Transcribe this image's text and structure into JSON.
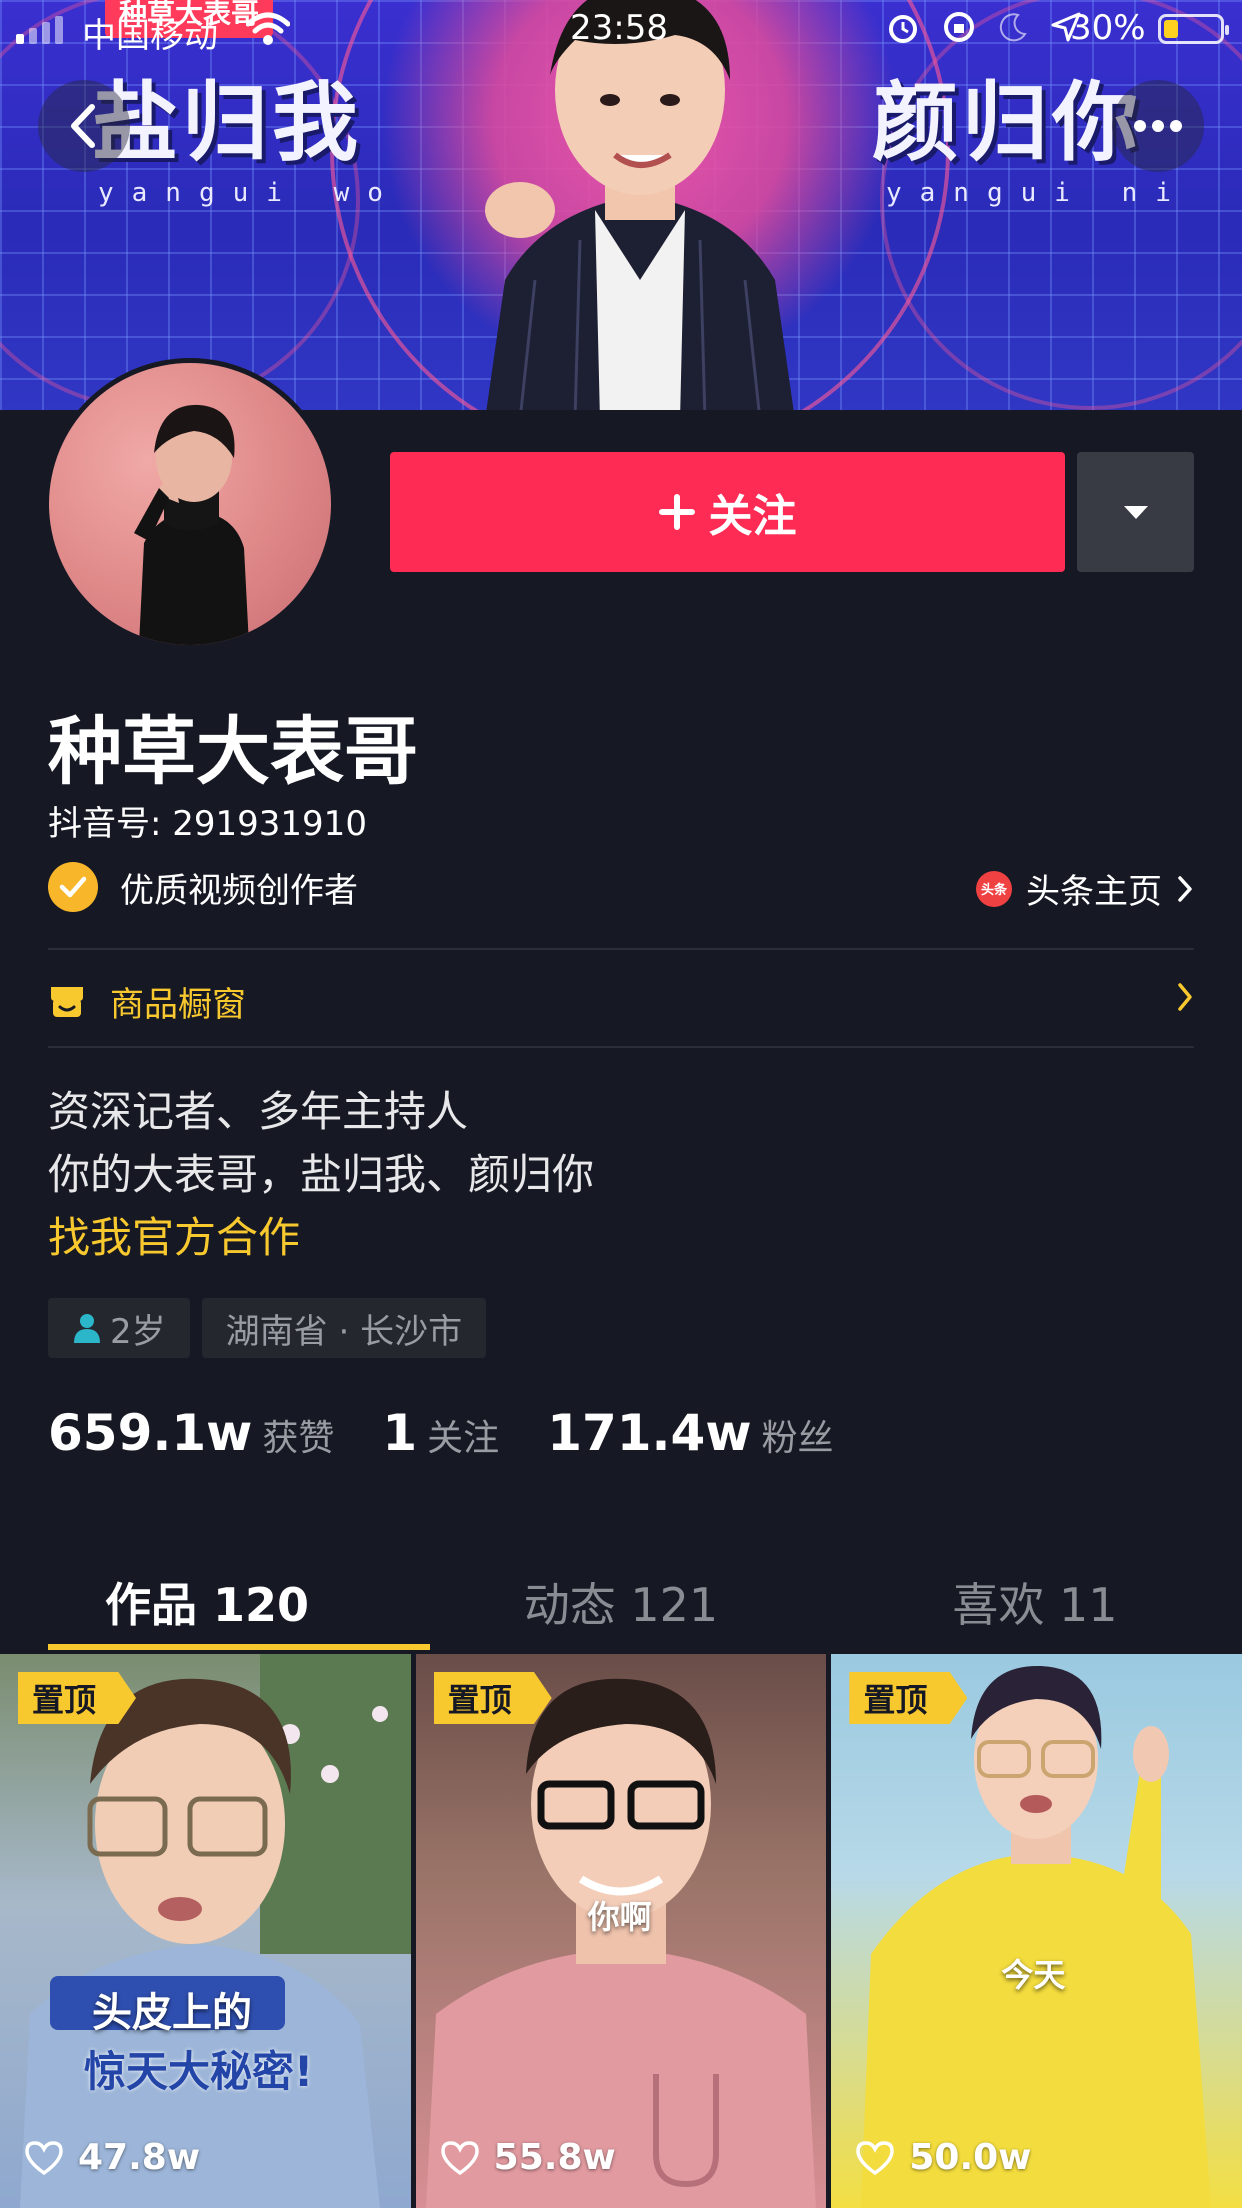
{
  "status_bar": {
    "carrier": "中国移动",
    "time": "23:58",
    "battery_percent": "30%",
    "battery_level": 0.3,
    "icons": [
      "signal-icon",
      "wifi-icon",
      "alarm-icon",
      "rotation-lock-icon",
      "moon-icon",
      "location-icon",
      "battery-icon"
    ]
  },
  "banner": {
    "left_title": "盐归我",
    "left_sub": "yangui wo",
    "right_title": "颜归你",
    "right_sub": "yangui ni"
  },
  "nav": {
    "back_icon": "chevron-left-icon",
    "more_icon": "more-dots-icon"
  },
  "actions": {
    "follow_label": "关注",
    "follow_icon": "plus-icon",
    "dropdown_icon": "triangle-down-icon"
  },
  "profile": {
    "name": "种草大表哥",
    "douyin_id": "抖音号: 291931910",
    "verified_label": "优质视频创作者",
    "toutiao_label": "头条主页",
    "toutiao_logo": "头条",
    "shop_label": "商品橱窗",
    "bio_lines": [
      "资深记者、多年主持人",
      "你的大表哥，盐归我、颜归你"
    ],
    "bio_link": "找我官方合作",
    "tags": {
      "age": "2岁",
      "location": "湖南省 · 长沙市"
    }
  },
  "stats": {
    "likes_num": "659.1w",
    "likes_label": "获赞",
    "following_num": "1",
    "following_label": "关注",
    "fans_num": "171.4w",
    "fans_label": "粉丝"
  },
  "tabs": [
    {
      "label": "作品 120",
      "active": true
    },
    {
      "label": "动态 121",
      "active": false
    },
    {
      "label": "喜欢 11",
      "active": false
    }
  ],
  "videos": [
    {
      "pin": "置顶",
      "likes": "47.8w",
      "caption_line1": "头皮上的",
      "caption_line2": "惊天大秘密!"
    },
    {
      "pin": "置顶",
      "likes": "55.8w",
      "caption": "你啊"
    },
    {
      "pin": "置顶",
      "likes": "50.0w",
      "caption": "今天"
    }
  ],
  "colors": {
    "background": "#161823",
    "follow_red": "#fe2c55",
    "accent_yellow": "#f8c82f",
    "muted_text": "#9a9ca3"
  }
}
